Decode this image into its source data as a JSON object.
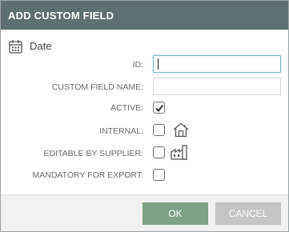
{
  "dialog": {
    "title": "ADD CUSTOM FIELD",
    "field_type": {
      "icon": "calendar-icon",
      "label": "Date"
    },
    "fields": {
      "id": {
        "label": "ID:",
        "value": "",
        "placeholder": ""
      },
      "name": {
        "label": "CUSTOM FIELD NAME:",
        "value": "",
        "placeholder": ""
      },
      "active": {
        "label": "ACTIVE:",
        "checked": true
      },
      "internal": {
        "label": "INTERNAL:",
        "checked": false,
        "icon": "house-icon"
      },
      "editable_by_supplier": {
        "label": "EDITABLE BY SUPPLIER:",
        "checked": false,
        "icon": "factory-icon"
      },
      "mandatory_for_export": {
        "label": "MANDATORY FOR EXPORT:",
        "checked": false
      }
    },
    "buttons": {
      "ok": "OK",
      "cancel": "CANCEL"
    }
  },
  "colors": {
    "title_bar": "#5d7072",
    "ok_button": "#7ea084",
    "cancel_button": "#c4c4c4",
    "focus_border": "#7ab7c8"
  }
}
